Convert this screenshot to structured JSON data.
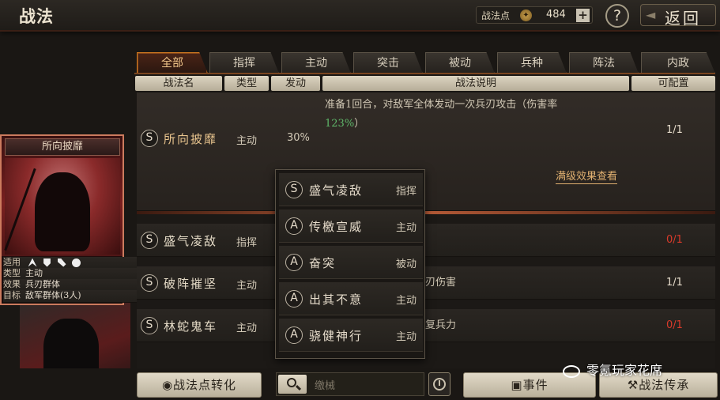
{
  "header": {
    "title": "战法",
    "points_label": "战法点",
    "points_value": "484",
    "plus": "+",
    "help": "?",
    "back": "返回"
  },
  "card": {
    "name": "所向披靡",
    "rows": [
      {
        "k": "适用",
        "v": ""
      },
      {
        "k": "类型",
        "v": "主动"
      },
      {
        "k": "效果",
        "v": "兵刃群体"
      },
      {
        "k": "目标",
        "v": "敌军群体(3人)"
      }
    ]
  },
  "tabs": [
    {
      "label": "全部",
      "active": true
    },
    {
      "label": "指挥"
    },
    {
      "label": "主动"
    },
    {
      "label": "突击"
    },
    {
      "label": "被动"
    },
    {
      "label": "兵种"
    },
    {
      "label": "阵法"
    },
    {
      "label": "内政"
    }
  ],
  "columns": {
    "name": "战法名",
    "type": "类型",
    "rate": "发动",
    "desc": "战法说明",
    "config": "可配置"
  },
  "rows": [
    {
      "grade": "S",
      "name": "所向披靡",
      "type": "主动",
      "rate": "30%",
      "desc_line1": "准备1回合，对敌军全体发动一次兵刃攻击（伤害率",
      "desc_line2": "123%",
      "desc_line2_tail": "）",
      "max_effect": "满级效果查看",
      "count": "1/1"
    },
    {
      "grade": "S",
      "name": "盛气凌敌",
      "type": "指挥",
      "desc": "",
      "count": "0/1"
    },
    {
      "grade": "S",
      "name": "破阵摧坚",
      "type": "主动",
      "desc": "刃伤害",
      "count": "1/1"
    },
    {
      "grade": "S",
      "name": "林蛇鬼车",
      "type": "主动",
      "desc": "复兵力",
      "count": "0/1"
    }
  ],
  "popup": [
    {
      "grade": "S",
      "name": "盛气凌敌",
      "type": "指挥"
    },
    {
      "grade": "A",
      "name": "传檄宣威",
      "type": "主动"
    },
    {
      "grade": "A",
      "name": "奋突",
      "type": "被动"
    },
    {
      "grade": "A",
      "name": "出其不意",
      "type": "主动"
    },
    {
      "grade": "A",
      "name": "骁健神行",
      "type": "主动"
    }
  ],
  "bottom": {
    "convert": "战法点转化",
    "search_placeholder": "缴械",
    "event": "事件",
    "inherit": "战法传承"
  },
  "watermark": "零氪玩家花席",
  "colors": {
    "accent_orange": "#c9761f",
    "count_red": "#d83a2a",
    "count_white": "#e6dccb",
    "green_value": "#5fb86a",
    "link_gold": "#e0b070"
  }
}
